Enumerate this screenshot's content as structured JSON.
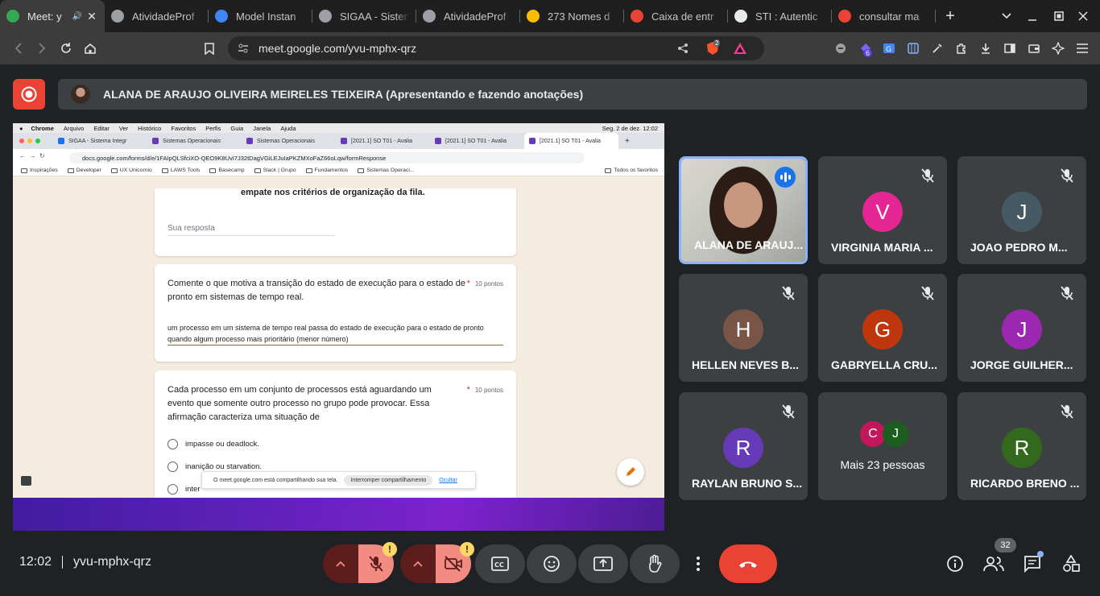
{
  "browser": {
    "tabs": [
      {
        "title": "Meet: y",
        "icon": "meet-icon",
        "active": true,
        "color": "#34a853"
      },
      {
        "title": "AtividadeProf",
        "icon": "globe-icon",
        "color": "#9aa0a6"
      },
      {
        "title": "Model Instan",
        "icon": "cube-icon",
        "color": "#4285f4"
      },
      {
        "title": "SIGAA - Sister",
        "icon": "globe-icon",
        "color": "#9aa0a6"
      },
      {
        "title": "AtividadeProf",
        "icon": "globe-icon",
        "color": "#9aa0a6"
      },
      {
        "title": "273 Nomes d",
        "icon": "bus-icon",
        "color": "#fbbc04"
      },
      {
        "title": "Caixa de entr",
        "icon": "gmail-icon",
        "color": "#ea4335"
      },
      {
        "title": "STI : Autentic",
        "icon": "sti-icon",
        "color": "#e8eaed"
      },
      {
        "title": "consultar ma",
        "icon": "red-circle-icon",
        "color": "#ea4335"
      }
    ],
    "url": "meet.google.com/yvu-mphx-qrz",
    "shield_count": "2",
    "extension_badge": "6"
  },
  "meet": {
    "presenter_banner": "ALANA DE ARAUJO OLIVEIRA MEIRELES TEIXEIRA (Apresentando e fazendo anotações)",
    "time": "12:02",
    "meeting_code": "yvu-mphx-qrz",
    "participant_count": "32",
    "colors": {
      "record": "#ea4335",
      "end_call": "#ea4335",
      "warning": "#fdd663",
      "speaking": "#8ab4f8"
    }
  },
  "shared_screen": {
    "mac_menu": [
      "Chrome",
      "Arquivo",
      "Editar",
      "Ver",
      "Histórico",
      "Favoritos",
      "Perfis",
      "Guia",
      "Janela",
      "Ajuda"
    ],
    "mac_clock": "Seg. 2 de dez.  12:02",
    "tabs": [
      {
        "title": "SIGAA - Sistema Integr",
        "color": "#1a73e8"
      },
      {
        "title": "Sistemas Operacionais",
        "color": "#673ab7"
      },
      {
        "title": "Sistemas Operacionais",
        "color": "#673ab7"
      },
      {
        "title": "[2021.1] SO T01 - Avalia",
        "color": "#673ab7"
      },
      {
        "title": "[2021.1] SO T01 - Avalia",
        "color": "#673ab7"
      },
      {
        "title": "[2021.1] SO T01 - Avalia",
        "color": "#673ab7"
      }
    ],
    "url": "docs.google.com/forms/d/e/1FAIpQLSfciXO-QEO9K8UvI7J32tDagVGiLEJuIaPKZMXoFaZ66oLqw/formResponse",
    "bookmarks": [
      "Inspirações",
      "Developer",
      "UX Unicornio",
      "LAWS Tools",
      "Basecamp",
      "Slack | Grupo",
      "Fundamentos",
      "Sistemas Operaci..."
    ],
    "all_bookmarks": "Todos os favoritos",
    "prev_question_tail": "empate nos critérios de organização da fila.",
    "prev_answer_placeholder": "Sua resposta",
    "q1": {
      "text": "Comente o que motiva a transição do estado de execução para o estado de pronto em sistemas de tempo real.",
      "points": "10 pontos",
      "answer": "um processo em um sistema de tempo real passa do estado de execução para o estado de pronto quando algum processo mais prioritário (menor número)"
    },
    "q2": {
      "text": "Cada processo em um conjunto de processos está aguardando um evento que somente outro processo no grupo pode provocar. Essa afirmação caracteriza uma situação de",
      "points": "10 pontos",
      "options": [
        "impasse ou deadlock.",
        "inanição ou starvation.",
        "inter"
      ]
    },
    "share_notice": "O meet.google.com está compartilhando sua tela.",
    "stop_sharing": "Interromper compartilhamento",
    "hide": "Ocultar"
  },
  "participants": [
    {
      "name": "ALANA DE ARAUJ...",
      "initial": "",
      "color": "",
      "video": true,
      "speaking": true
    },
    {
      "name": "VIRGINIA MARIA ...",
      "initial": "V",
      "color": "#e52592"
    },
    {
      "name": "JOAO PEDRO M...",
      "initial": "J",
      "color": "#455a64"
    },
    {
      "name": "HELLEN NEVES B...",
      "initial": "H",
      "color": "#795548"
    },
    {
      "name": "GABRYELLA CRU...",
      "initial": "G",
      "color": "#bf360c"
    },
    {
      "name": "JORGE GUILHER...",
      "initial": "J",
      "color": "#9c27b0"
    },
    {
      "name": "RAYLAN BRUNO S...",
      "initial": "R",
      "color": "#673ab7"
    },
    {
      "name": "RICARDO BRENO ...",
      "initial": "R",
      "color": "#33691e"
    }
  ],
  "more_people": {
    "label": "Mais 23 pessoas",
    "initials": [
      "C",
      "J"
    ],
    "colors": [
      "#c2185b",
      "#1b5e20"
    ]
  }
}
